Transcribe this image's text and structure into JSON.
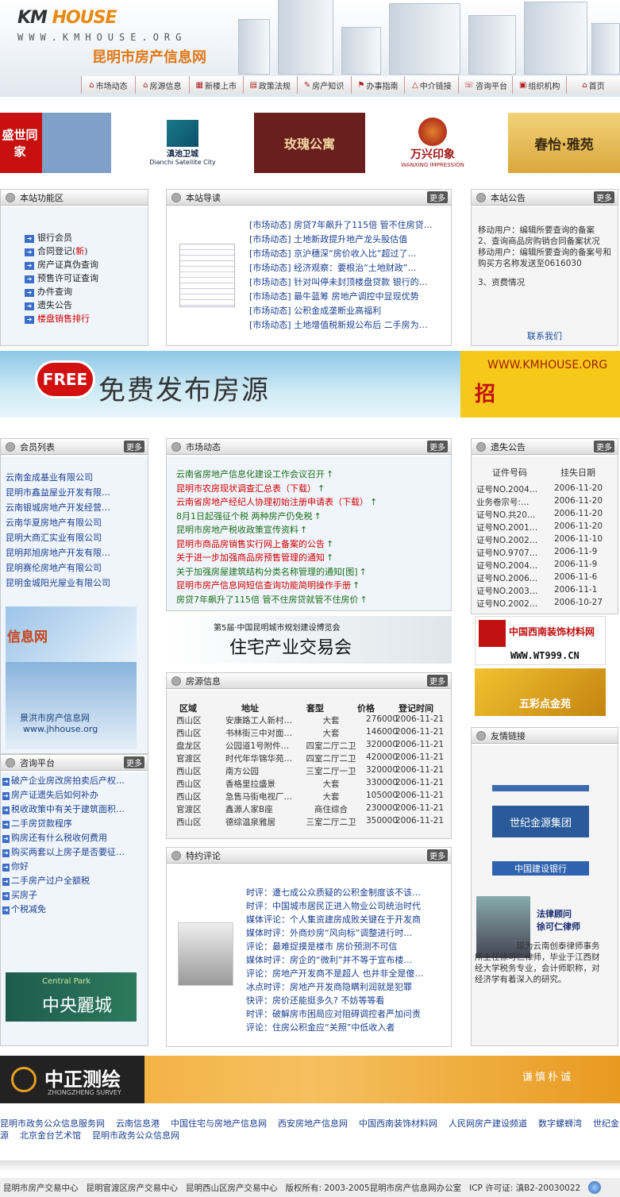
{
  "header": {
    "logo_km": "KM",
    "logo_house": "HOUSE",
    "site_url": "WWW.KMHOUSE.ORG",
    "site_name": "昆明市房产信息网"
  },
  "nav": [
    "市场动态",
    "房源信息",
    "新楼上市",
    "政策法规",
    "房产知识",
    "办事指南",
    "中介链接",
    "咨询平台",
    "组织机构",
    "首页"
  ],
  "ads": [
    "盛世同家",
    "滇池卫城",
    "玫瑰公寓",
    "万兴印象",
    "春怡·雅苑"
  ],
  "ads_sub": [
    "Dianchi Satellite City",
    "WANXING IMPRESSION"
  ],
  "func": {
    "title": "本站功能区",
    "items": [
      "银行会员",
      "合同登记",
      "房产证真伪查询",
      "预售许可证查询",
      "办件查询",
      "遗失公告",
      "楼盘销售排行"
    ],
    "new_tag": "新"
  },
  "guide": {
    "title": "本站导读",
    "more": "更多",
    "items": [
      "[市场动态] 房贷7年飙升了115倍 管不住房贷…",
      "[市场动态] 土地新政提升地产龙头股估值",
      "[市场动态] 京沪穗深“房价收入比”超过了…",
      "[市场动态] 经济观察：要根治“土地财政”…",
      "[市场动态] 针对叫停未封顶楼盘贷款 银行的…",
      "[市场动态] 最牛蓝筹 房地产调控中显现优势",
      "[市场动态] 公积金成垄断业高福利",
      "[市场动态] 土地增值税新规公布后 二手房为…"
    ]
  },
  "notice": {
    "title": "本站公告",
    "more": "更多",
    "text": [
      "移动用户：编辑所要查询的备案",
      "2、查询商品房购销合同备案状况",
      "移动用户：编辑所要查询的备案号和购买方名称发送至0616030",
      "3、资费情况"
    ],
    "contact": "联系我们"
  },
  "banner": {
    "free": "FREE",
    "text": "免费发布房源",
    "url": "WWW.KMHOUSE.ORG",
    "zhao": "招"
  },
  "members": {
    "title": "会员列表",
    "more": "更多",
    "items": [
      "云南金成基业有限公司",
      "昆明市鑫益屋业开发有限…",
      "云南银城房地产开发经营…",
      "云南华夏房地产有限公司",
      "昆明大商汇实业有限公司",
      "昆明邦旭房地产开发有限…",
      "昆明赛伦房地产有限公司",
      "昆明金城阳光屋业有限公司"
    ],
    "ad1": "信息网",
    "ad2": "景洪市房产信息网",
    "ad2url": "www.jhhouse.org"
  },
  "market": {
    "title": "市场动态",
    "more": "更多",
    "items": [
      {
        "t": "云南省房地产信息化建设工作会议召开",
        "c": "grn"
      },
      {
        "t": "昆明市农房现状调查汇总表（下载）",
        "c": "red"
      },
      {
        "t": "云南省房地产经纪人协理初始注册申请表（下载）",
        "c": "red"
      },
      {
        "t": "8月1日起强征个税 两种房产仍免税",
        "c": "grn"
      },
      {
        "t": "昆明市房地产税收政策宣传资料",
        "c": "grn"
      },
      {
        "t": "昆明市商品房销售实行网上备案的公告",
        "c": "red"
      },
      {
        "t": "关于进一步加强商品房预售管理的通知",
        "c": "red"
      },
      {
        "t": "关于加强房屋建筑结构分类名称管理的通知[图]",
        "c": "grn"
      },
      {
        "t": "昆明市房产信息网短信查询功能简明操作手册",
        "c": "red"
      },
      {
        "t": "房贷7年飙升了115倍 管不住房贷就管不住房价",
        "c": "grn"
      }
    ],
    "expo1": "第5届·中国昆明城市规划建设博览会",
    "expo2": "住宅产业交易会"
  },
  "lost": {
    "title": "遗失公告",
    "more": "更多",
    "h1": "证件号码",
    "h2": "挂失日期",
    "rows": [
      [
        "证号NO.2004…",
        "2006-11-20"
      ],
      [
        "业务卷宗号:…",
        "2006-11-20"
      ],
      [
        "证号NO.共20…",
        "2006-11-20"
      ],
      [
        "证号NO.2001…",
        "2006-11-20"
      ],
      [
        "证号NO.2002…",
        "2006-11-10"
      ],
      [
        "证号NO.9707…",
        "2006-11-9"
      ],
      [
        "证号NO.2004…",
        "2006-11-9"
      ],
      [
        "证号NO.2006…",
        "2006-11-6"
      ],
      [
        "证号NO.2003…",
        "2006-11-1"
      ],
      [
        "证号NO.2002…",
        "2006-10-27"
      ]
    ],
    "ad1": "中国西南装饰材料网",
    "ad1url": "WWW.WT999.CN",
    "ad2": "五彩点金苑"
  },
  "consult": {
    "title": "咨询平台",
    "more": "更多",
    "items": [
      "破产企业房改房拍卖后产权…",
      "房产证遗失后如何补办",
      "税收政策中有关于建筑面积…",
      "二手房贷款程序",
      "购房还有什么税收何费用",
      "购买两套以上房子是否要征…",
      "你好",
      "二手房产过户全额税",
      "买房子",
      "个税减免"
    ],
    "ad": "中央麗城",
    "ad_en": "Central Park"
  },
  "houses": {
    "title": "房源信息",
    "more": "更多",
    "cols": [
      "区域",
      "地址",
      "套型",
      "价格",
      "登记时间"
    ],
    "rows": [
      [
        "西山区",
        "安康路工人新村…",
        "大套",
        "276000",
        "2006-11-21"
      ],
      [
        "西山区",
        "书林街三中对面…",
        "大套",
        "146000",
        "2006-11-21"
      ],
      [
        "盘龙区",
        "公园道1号附件…",
        "四室二厅二卫",
        "320000",
        "2006-11-21"
      ],
      [
        "官渡区",
        "时代年华锦华苑…",
        "四室二厅二卫",
        "420000",
        "2006-11-21"
      ],
      [
        "西山区",
        "南方公园",
        "三室二厅一卫",
        "320000",
        "2006-11-21"
      ],
      [
        "西山区",
        "香格里拉盛景",
        "大套",
        "330000",
        "2006-11-21"
      ],
      [
        "西山区",
        "急售马街电视厂…",
        "大套",
        "105000",
        "2006-11-21"
      ],
      [
        "官渡区",
        "鑫源人家B座",
        "商住综合",
        "230000",
        "2006-11-21"
      ],
      [
        "西山区",
        "德综温泉雅居",
        "三室二厅二卫",
        "350000",
        "2006-11-21"
      ]
    ]
  },
  "friends": {
    "title": "友情链接",
    "link1": "世纪金源集团",
    "link2": "中国建设银行"
  },
  "comment": {
    "title": "特约评论",
    "more": "更多",
    "items": [
      "时评：遭七成公众质疑的公积金制度该不该…",
      "时评：中国城市居民正进入物业公司统治时代",
      "媒体评论：个人集资建房成败关键在于开发商",
      "媒体时评：外商炒房“风向标”调整进行时…",
      "评论：最难捉摸是楼市 房价预测不可信",
      "媒体时评：房企的“微利”并不等于宣布楼…",
      "评论：房地产开发商不是超人 也并非全是傻…",
      "冰点时评：房地产开发商隐瞒利润就是犯罪",
      "快评：房价还能挺多久? 不妨等等看",
      "时评：破解房市困局应对阻碍调控者严加问责",
      "评论：住房公积金应“关照”中低收入者"
    ]
  },
  "lawyer": {
    "title1": "法律顾问",
    "title2": "徐可仁律师",
    "text": "现为云南创泰律师事务所主任徐可仁律师，毕业于江西财经大学税务专业，会计师职称，对经济学有着深入的研究。"
  },
  "bottom_ad": {
    "name": "中正测绘",
    "en": "ZHONGZHENG SURVEY",
    "slogan": "谦慎朴诚"
  },
  "links": [
    "昆明市政务公众信息服务网",
    "云南信息港",
    "中国住宅与房地产信息网",
    "西安房地产信息网",
    "中国西南装饰材料网",
    "人民网房产建设频道",
    "数字螺蛳湾",
    "世纪金源",
    "北京金台艺术馆",
    "昆明市政务公众信息网"
  ],
  "footer": {
    "items": [
      "昆明市房产交易中心",
      "昆明官渡区房产交易中心",
      "昆明西山区房产交易中心"
    ],
    "copy": "版权所有: 2003-2005昆明市房产信息网办公室",
    "icp": "ICP 许可证: 滇B2-20030022"
  }
}
